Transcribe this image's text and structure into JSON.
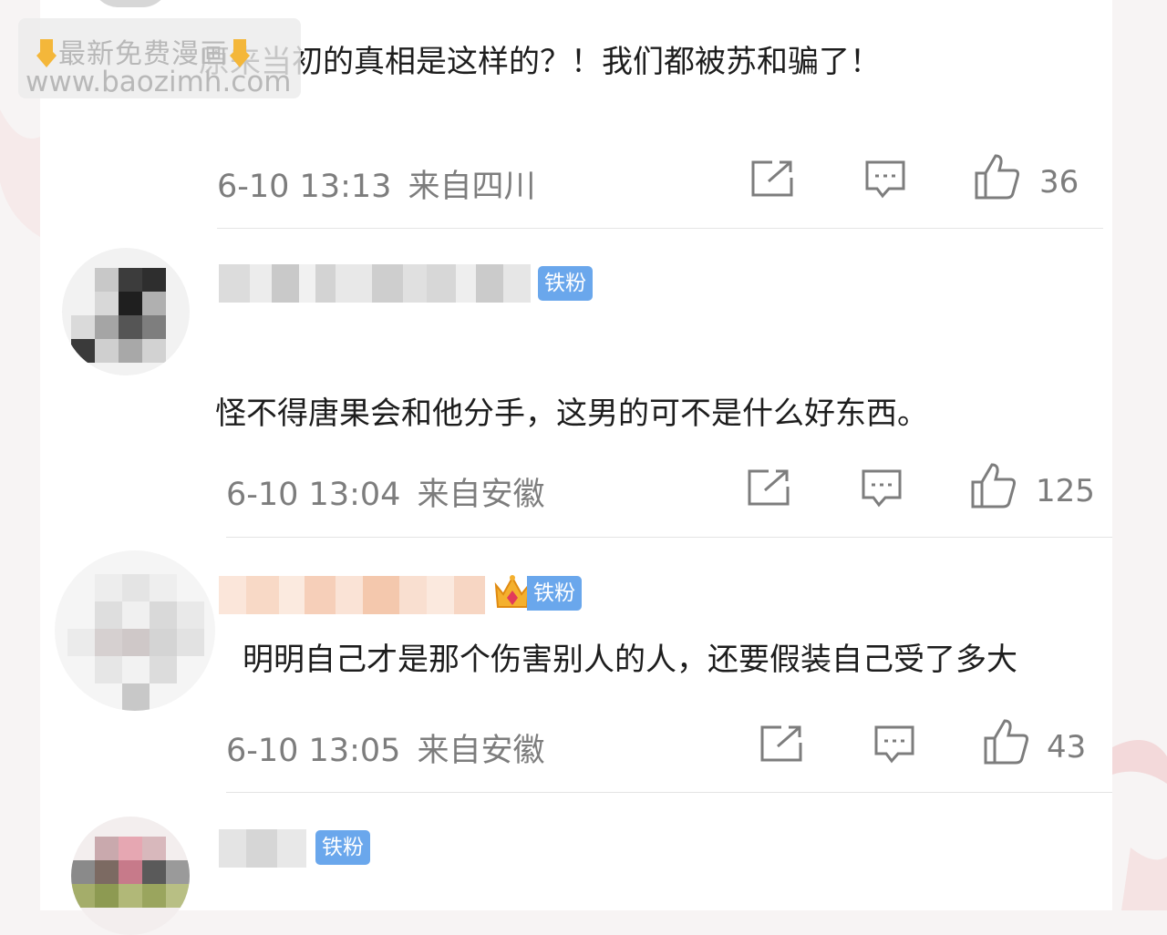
{
  "watermark": {
    "line1": "最新免费漫画",
    "line2": "www.baozimh.com"
  },
  "comments": [
    {
      "text": "原来当初的真相是这样的？！我们都被苏和骗了！",
      "time": "6-10 13:13",
      "location": "来自四川",
      "likes": "36"
    },
    {
      "badge": "铁粉",
      "text": "怪不得唐果会和他分手，这男的可不是什么好东西。",
      "time": "6-10 13:04",
      "location": "来自安徽",
      "likes": "125"
    },
    {
      "badge": "铁粉",
      "text": "明明自己才是那个伤害别人的人，还要假装自己受了多大",
      "time": "6-10 13:05",
      "location": "来自安徽",
      "likes": "43"
    },
    {
      "badge": "铁粉"
    }
  ],
  "icons": {
    "share": "share-icon",
    "comment": "comment-icon",
    "like": "thumbs-up-icon",
    "crown": "crown-icon",
    "pointing": "pointing-down-icon"
  },
  "colors": {
    "badge": "#6aa7ec",
    "text": "#1d1d1d",
    "meta": "#7d7d7d"
  }
}
